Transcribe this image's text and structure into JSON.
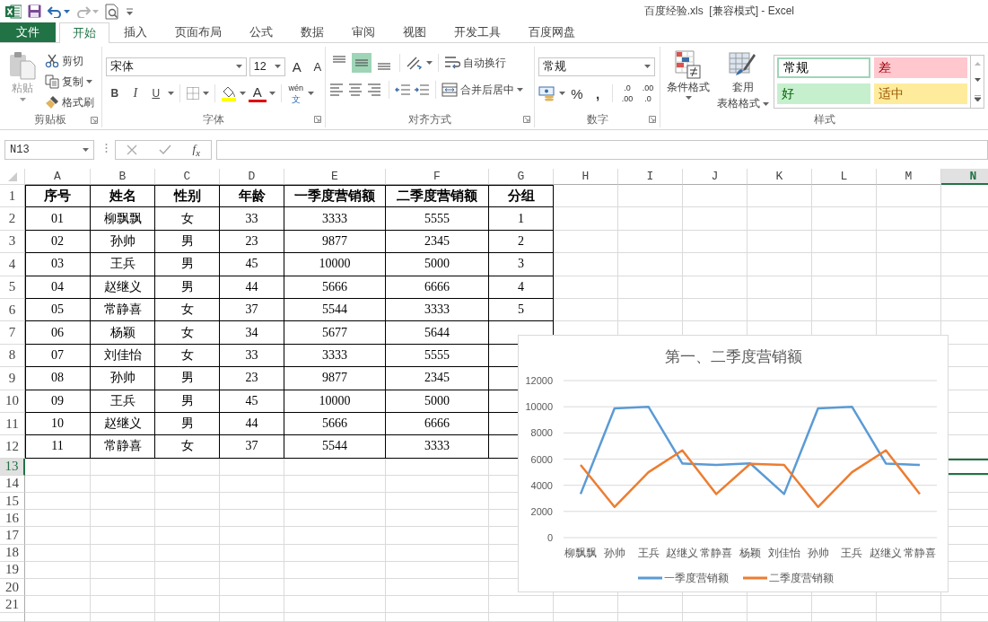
{
  "window": {
    "title": "百度经验.xls  [兼容模式] - Excel"
  },
  "quick_access": [
    {
      "kind": "undo",
      "disabled": false
    },
    {
      "kind": "redo",
      "disabled": true
    }
  ],
  "tabs": [
    {
      "label": "文件",
      "kind": "file",
      "selected": false
    },
    {
      "label": "开始",
      "kind": "tab",
      "selected": true
    },
    {
      "label": "插入",
      "kind": "tab",
      "selected": false
    },
    {
      "label": "页面布局",
      "kind": "tab",
      "selected": false
    },
    {
      "label": "公式",
      "kind": "tab",
      "selected": false
    },
    {
      "label": "数据",
      "kind": "tab",
      "selected": false
    },
    {
      "label": "审阅",
      "kind": "tab",
      "selected": false
    },
    {
      "label": "视图",
      "kind": "tab",
      "selected": false
    },
    {
      "label": "开发工具",
      "kind": "tab",
      "selected": false
    },
    {
      "label": "百度网盘",
      "kind": "tab",
      "selected": false
    }
  ],
  "ribbon": {
    "clipboard": {
      "label": "剪贴板",
      "paste": {
        "label": "粘贴",
        "disabled": true
      },
      "cut": "剪切",
      "copy": "复制",
      "format_painter": "格式刷"
    },
    "font": {
      "label": "字体",
      "font_name": "宋体",
      "font_size": "12",
      "grow": "A",
      "shrink": "A",
      "bold": "B",
      "italic": "I",
      "underline": "U",
      "font_color": "A",
      "phonetic": [
        "wén",
        "文"
      ]
    },
    "alignment": {
      "label": "对齐方式",
      "vertical": [
        {
          "kind": "top",
          "selected": false
        },
        {
          "kind": "middle",
          "selected": true
        },
        {
          "kind": "bottom",
          "selected": false
        }
      ],
      "horizontal": [
        {
          "kind": "left"
        },
        {
          "kind": "center"
        },
        {
          "kind": "right"
        }
      ],
      "wrap_text": "自动换行",
      "merge_center": "合并后居中"
    },
    "number": {
      "label": "数字",
      "format": "常规",
      "percent": "%",
      "comma": ",",
      "increase_decimal": [
        ".0",
        ".00"
      ],
      "decrease_decimal": [
        ".00",
        ".0"
      ]
    },
    "styles": {
      "label": "样式",
      "conditional_format": "条件格式",
      "format_as_table": [
        "套用",
        "表格格式"
      ],
      "cells": [
        {
          "label": "常规",
          "kind": "normal",
          "color": "#ffffff",
          "selected": true
        },
        {
          "label": "差",
          "kind": "bad",
          "color": "#ffc7ce",
          "selected": false
        },
        {
          "label": "好",
          "kind": "good",
          "color": "#c6efce",
          "selected": false
        },
        {
          "label": "适中",
          "kind": "neutral",
          "color": "#ffeb9c",
          "selected": false
        }
      ]
    }
  },
  "formula_bar": {
    "name_box": "N13",
    "function_button": "f$_{x}$"
  },
  "sheet": {
    "columns": [
      {
        "label": "A",
        "selected": false
      },
      {
        "label": "B",
        "selected": false
      },
      {
        "label": "C",
        "selected": false
      },
      {
        "label": "D",
        "selected": false
      },
      {
        "label": "E",
        "selected": false
      },
      {
        "label": "F",
        "selected": false
      },
      {
        "label": "G",
        "selected": false
      },
      {
        "label": "H",
        "selected": false
      },
      {
        "label": "I",
        "selected": false
      },
      {
        "label": "J",
        "selected": false
      },
      {
        "label": "K",
        "selected": false
      },
      {
        "label": "L",
        "selected": false
      },
      {
        "label": "M",
        "selected": false
      },
      {
        "label": "N",
        "selected": true
      }
    ],
    "rows": [
      {
        "label": "1",
        "kind": "header",
        "selected": false,
        "cells": [
          "序号",
          "姓名",
          "性别",
          "年龄",
          "一季度营销额",
          "二季度营销额",
          "分组"
        ]
      },
      {
        "label": "2",
        "kind": "data",
        "selected": false,
        "cells": [
          "01",
          "柳飘飘",
          "女",
          "33",
          "3333",
          "5555",
          "1"
        ]
      },
      {
        "label": "3",
        "kind": "data",
        "selected": false,
        "cells": [
          "02",
          "孙帅",
          "男",
          "23",
          "9877",
          "2345",
          "2"
        ]
      },
      {
        "label": "4",
        "kind": "data",
        "selected": false,
        "cells": [
          "03",
          "王兵",
          "男",
          "45",
          "10000",
          "5000",
          "3"
        ]
      },
      {
        "label": "5",
        "kind": "data",
        "selected": false,
        "cells": [
          "04",
          "赵继义",
          "男",
          "44",
          "5666",
          "6666",
          "4"
        ]
      },
      {
        "label": "6",
        "kind": "data",
        "selected": false,
        "cells": [
          "05",
          "常静喜",
          "女",
          "37",
          "5544",
          "3333",
          "5"
        ]
      },
      {
        "label": "7",
        "kind": "data",
        "selected": false,
        "cells": [
          "06",
          "杨颖",
          "女",
          "34",
          "5677",
          "5644"
        ]
      },
      {
        "label": "8",
        "kind": "data",
        "selected": false,
        "cells": [
          "07",
          "刘佳怡",
          "女",
          "33",
          "3333",
          "5555"
        ]
      },
      {
        "label": "9",
        "kind": "data",
        "selected": false,
        "cells": [
          "08",
          "孙帅",
          "男",
          "23",
          "9877",
          "2345"
        ]
      },
      {
        "label": "10",
        "kind": "data",
        "selected": false,
        "cells": [
          "09",
          "王兵",
          "男",
          "45",
          "10000",
          "5000"
        ]
      },
      {
        "label": "11",
        "kind": "data",
        "selected": false,
        "cells": [
          "10",
          "赵继义",
          "男",
          "44",
          "5666",
          "6666"
        ]
      },
      {
        "label": "12",
        "kind": "data",
        "selected": false,
        "cells": [
          "11",
          "常静喜",
          "女",
          "37",
          "5544",
          "3333"
        ]
      },
      {
        "label": "13",
        "kind": "empty",
        "selected": true
      },
      {
        "label": "14",
        "kind": "empty",
        "selected": false
      },
      {
        "label": "15",
        "kind": "empty",
        "selected": false
      },
      {
        "label": "16",
        "kind": "empty",
        "selected": false
      },
      {
        "label": "17",
        "kind": "empty",
        "selected": false
      },
      {
        "label": "18",
        "kind": "empty",
        "selected": false
      },
      {
        "label": "19",
        "kind": "empty",
        "selected": false
      },
      {
        "label": "20",
        "kind": "empty",
        "selected": false
      },
      {
        "label": "21",
        "kind": "empty",
        "selected": false
      }
    ],
    "chart": {
      "chart_data": {
        "type": "line",
        "title": "第一、二季度营销额",
        "categories": [
          "柳飘飘",
          "孙帅",
          "王兵",
          "赵继义",
          "常静喜",
          "杨颖",
          "刘佳怡",
          "孙帅",
          "王兵",
          "赵继义",
          "常静喜"
        ],
        "ylim": [
          0,
          12000
        ],
        "grid": true,
        "legend": "bottom",
        "yticks": [
          0,
          2000,
          4000,
          6000,
          8000,
          10000,
          12000
        ],
        "series": [
          {
            "name": "一季度营销额",
            "color": "#5b9bd5",
            "values": [
              3333,
              9877,
              10000,
              5666,
              5544,
              5677,
              3333,
              9877,
              10000,
              5666,
              5544
            ]
          },
          {
            "name": "二季度营销额",
            "color": "#ed7d31",
            "values": [
              5555,
              2345,
              5000,
              6666,
              3333,
              5644,
              5555,
              2345,
              5000,
              6666,
              3333
            ]
          }
        ]
      }
    }
  }
}
